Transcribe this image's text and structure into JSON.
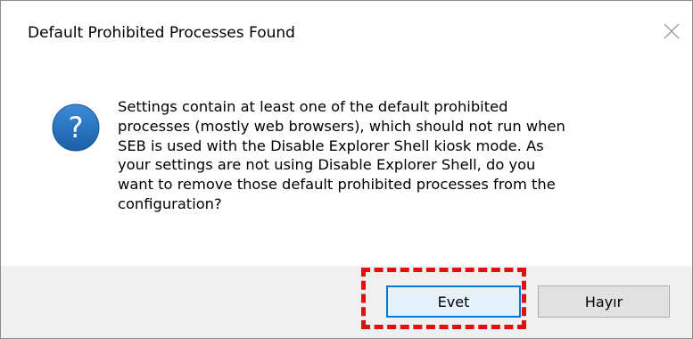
{
  "dialog": {
    "title": "Default Prohibited Processes Found",
    "icon": "question-icon",
    "message_lines": [
      "Settings contain at least one of the default prohibited",
      "processes (mostly web browsers), which should not run when",
      "SEB is used with the Disable Explorer Shell kiosk mode. As",
      "your settings are not using Disable Explorer Shell, do you",
      "want to remove those default prohibited processes from the",
      "configuration?"
    ],
    "buttons": {
      "yes_label": "Evet",
      "no_label": "Hayır"
    }
  },
  "colors": {
    "icon_blue": "#1e6ab5",
    "highlight_red": "#e01010",
    "default_button_border": "#0078d7",
    "footer_background": "#f0f0f0"
  }
}
